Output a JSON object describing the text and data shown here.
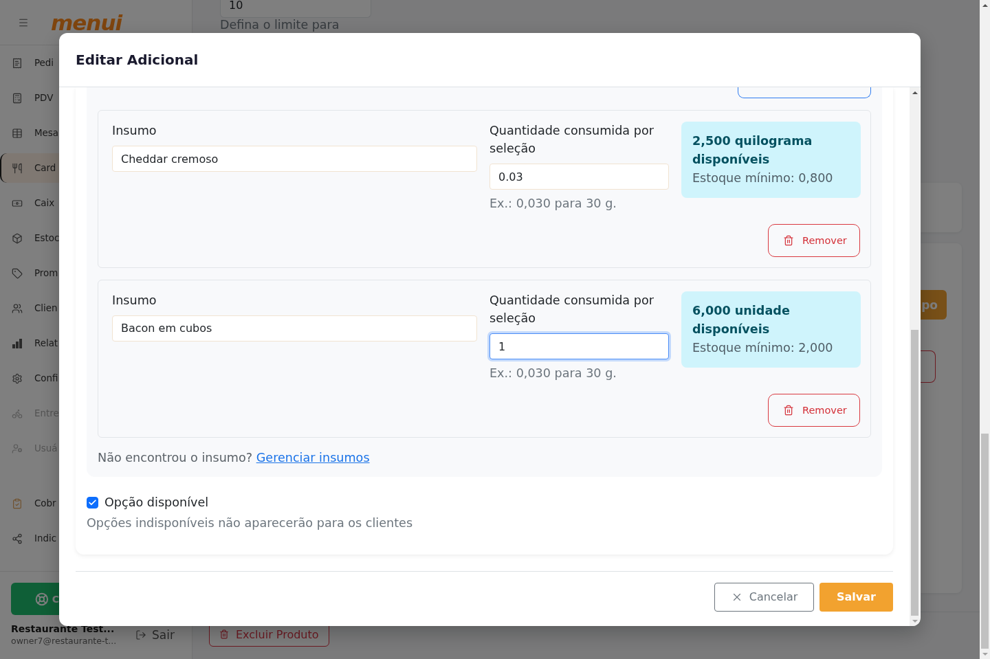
{
  "sidebar": {
    "logo": "menui",
    "sections": [
      {
        "items": [
          {
            "label": "Pedi",
            "selected": false,
            "disabled": false
          },
          {
            "label": "PDV",
            "selected": false,
            "disabled": false
          },
          {
            "label": "Mesa",
            "selected": false,
            "disabled": false
          },
          {
            "label": "Card",
            "selected": true,
            "disabled": false
          },
          {
            "label": "Caix",
            "selected": false,
            "disabled": false
          },
          {
            "label": "Estoc",
            "selected": false,
            "disabled": false
          },
          {
            "label": "Prom",
            "selected": false,
            "disabled": false
          },
          {
            "label": "Clien",
            "selected": false,
            "disabled": false
          },
          {
            "label": "Relat",
            "selected": false,
            "disabled": false
          },
          {
            "label": "Confi",
            "selected": false,
            "disabled": false
          },
          {
            "label": "Entre",
            "selected": false,
            "disabled": true
          },
          {
            "label": "Usuá",
            "selected": false,
            "disabled": true
          }
        ]
      },
      {
        "items": [
          {
            "label": "Cobr",
            "selected": false,
            "disabled": false
          },
          {
            "label": "Indic",
            "selected": false,
            "disabled": false
          }
        ]
      }
    ],
    "help_button": "C",
    "account": {
      "name": "Restaurante Test...",
      "email": "owner7@restaurante-t..."
    },
    "logout": "Sair"
  },
  "page": {
    "limit_value": "10",
    "limit_hint": "Defina o limite para",
    "partial_button": "po",
    "delete_button": "Excluir Produto"
  },
  "modal": {
    "title": "Editar Adicional",
    "supplies": [
      {
        "label": "Insumo",
        "supply": "Cheddar cremoso",
        "quantity_label": "Quantidade consumida por seleção",
        "quantity": "0.03",
        "focused": false,
        "hint": "Ex.: 0,030 para 30 g.",
        "stock": "2,500 quilograma disponíveis",
        "minimum": "Estoque mínimo: 0,800",
        "remove": "Remover"
      },
      {
        "label": "Insumo",
        "supply": "Bacon em cubos",
        "quantity_label": "Quantidade consumida por seleção",
        "quantity": "1",
        "focused": true,
        "hint": "Ex.: 0,030 para 30 g.",
        "stock": "6,000 unidade disponíveis",
        "minimum": "Estoque mínimo: 2,000",
        "remove": "Remover"
      }
    ],
    "missing": "Não encontrou o insumo?",
    "manage_link": "Gerenciar insumos",
    "available": {
      "label": "Opção disponível",
      "checked": true
    },
    "available_hint": "Opções indisponíveis não aparecerão para os clientes",
    "actions": [
      {
        "kind": "cancel",
        "label": "Cancelar"
      },
      {
        "kind": "save",
        "label": "Salvar"
      }
    ]
  }
}
